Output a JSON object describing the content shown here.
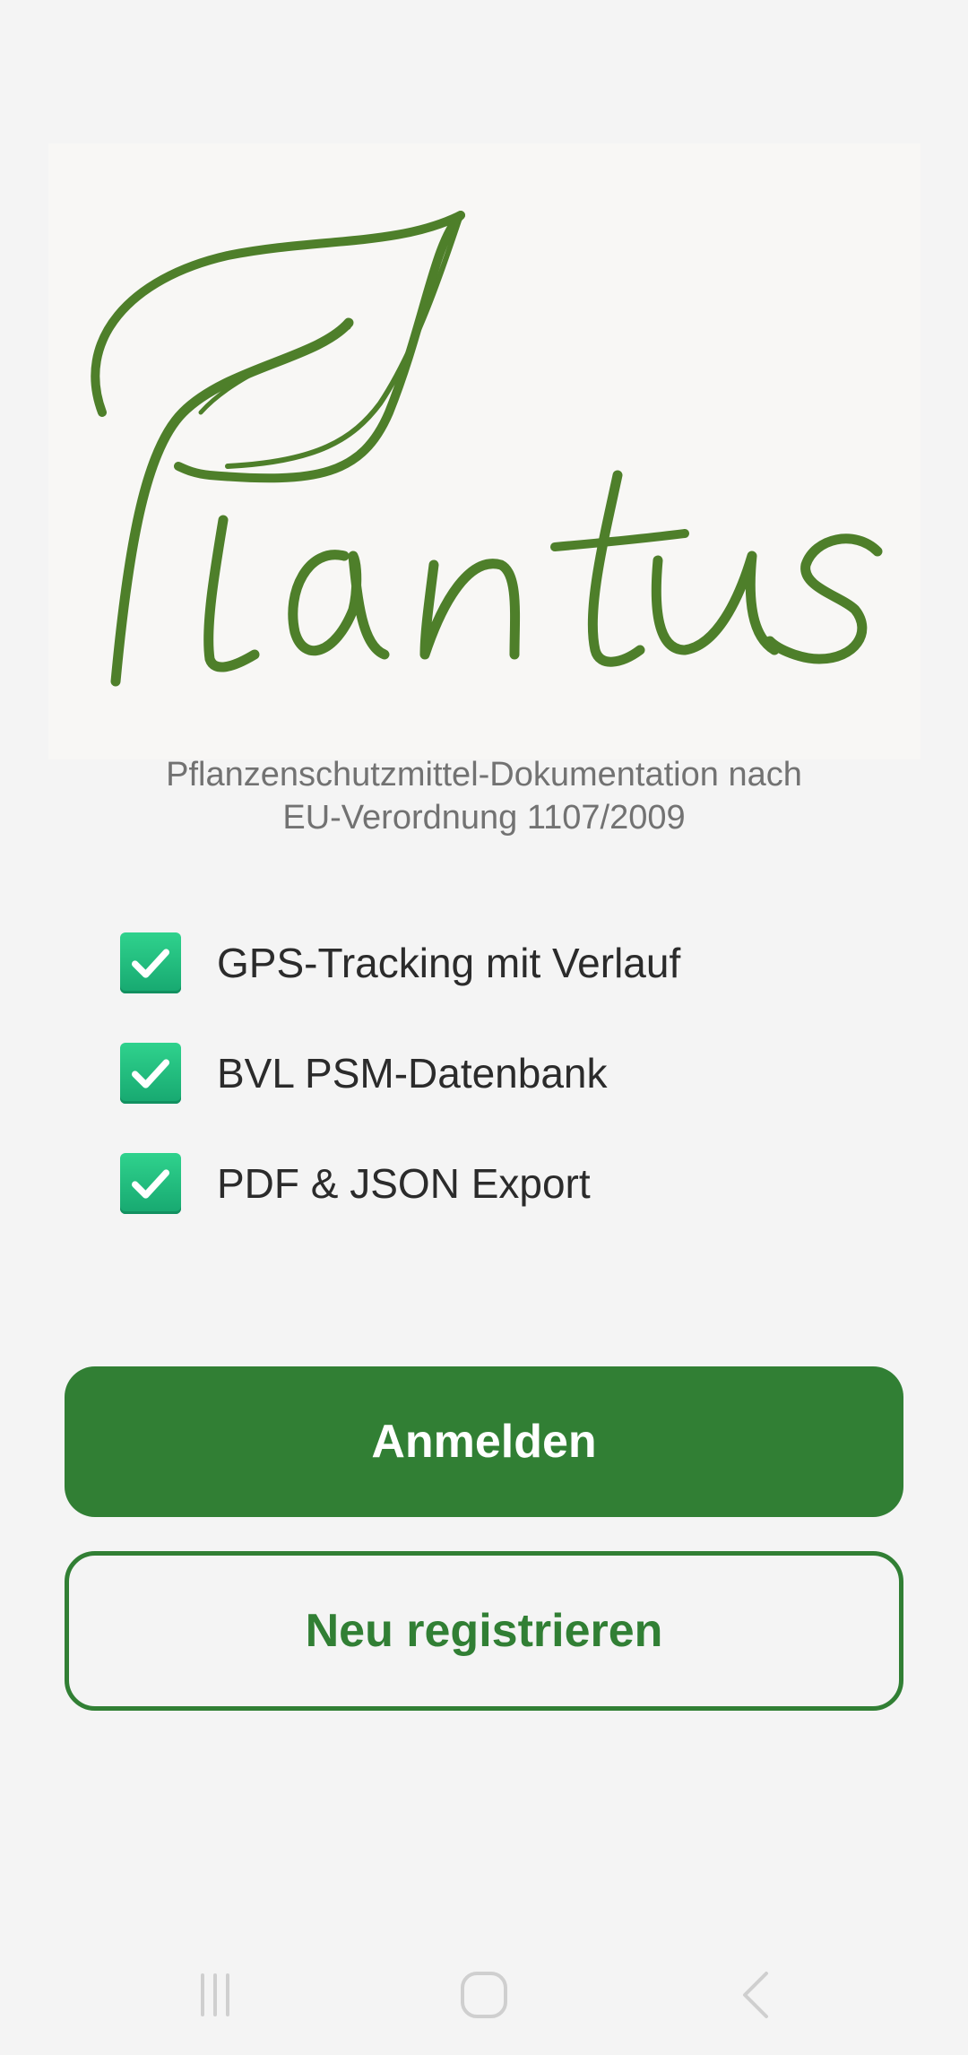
{
  "logo": {
    "text": "Plantus",
    "color": "#4e7f2a"
  },
  "subtitle": {
    "line1": "Pflanzenschutzmittel-Dokumentation nach",
    "line2": "EU-Verordnung 1107/2009"
  },
  "features": [
    {
      "label": "GPS-Tracking mit Verlauf",
      "icon": "check-box-icon"
    },
    {
      "label": "BVL PSM-Datenbank",
      "icon": "check-box-icon"
    },
    {
      "label": "PDF & JSON Export",
      "icon": "check-box-icon"
    }
  ],
  "buttons": {
    "login_label": "Anmelden",
    "register_label": "Neu registrieren"
  },
  "colors": {
    "primary": "#317f34",
    "background": "#f4f4f4",
    "check": "#20b97a"
  },
  "navbar": {
    "recents_icon": "recents-icon",
    "home_icon": "home-icon",
    "back_icon": "back-icon"
  }
}
